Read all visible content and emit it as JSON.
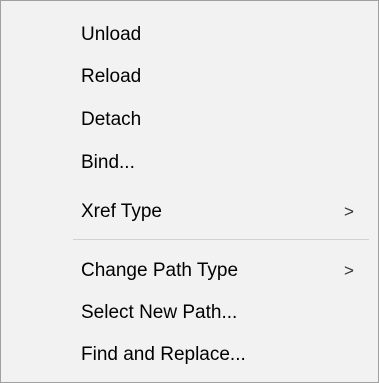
{
  "context_menu": {
    "items": [
      {
        "label": "Unload",
        "submenu": false
      },
      {
        "label": "Reload",
        "submenu": false
      },
      {
        "label": "Detach",
        "submenu": false
      },
      {
        "label": "Bind...",
        "submenu": false
      },
      {
        "label": "Xref Type",
        "submenu": true,
        "arrow": ">"
      },
      {
        "label": "Change Path Type",
        "submenu": true,
        "arrow": ">"
      },
      {
        "label": "Select New Path...",
        "submenu": false
      },
      {
        "label": "Find and Replace...",
        "submenu": false
      }
    ]
  }
}
